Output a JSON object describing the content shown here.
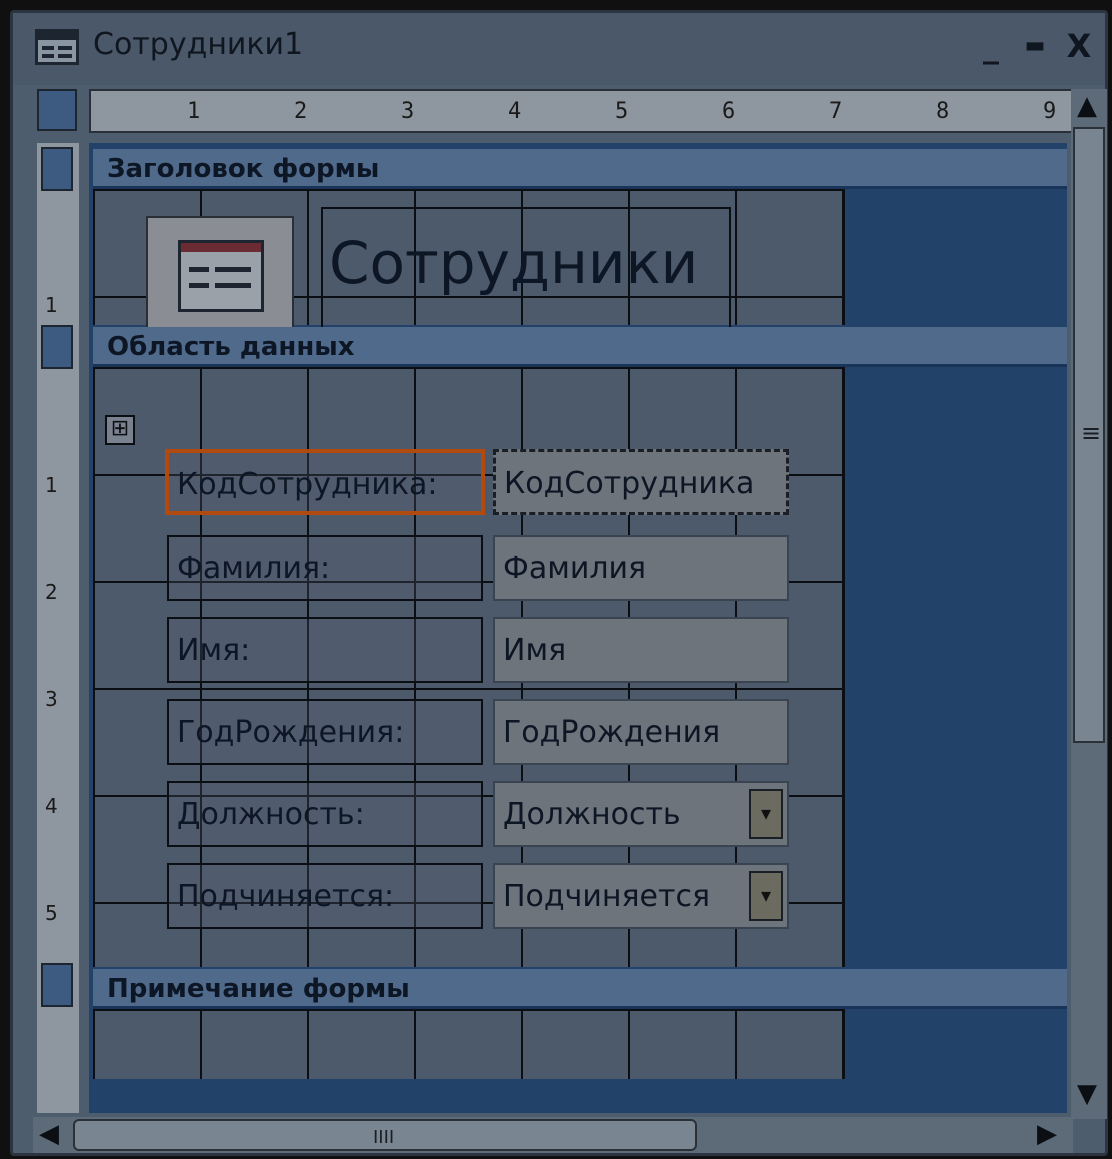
{
  "window": {
    "title": "Сотрудники1",
    "minimize_glyph": "_",
    "maximize_glyph": "▬",
    "close_glyph": "X"
  },
  "ruler": {
    "horizontal": [
      "1",
      "2",
      "3",
      "4",
      "5",
      "6",
      "7",
      "8",
      "9"
    ],
    "vertical": [
      "1",
      "1",
      "2",
      "3",
      "4",
      "5"
    ]
  },
  "sections": {
    "header": "Заголовок формы",
    "detail": "Область данных",
    "footer": "Примечание формы"
  },
  "header": {
    "title": "Сотрудники",
    "logo_icon": "form-icon"
  },
  "controls": [
    {
      "label": "КодСотрудника:",
      "field": "КодСотрудника",
      "kind": "text",
      "selected": true
    },
    {
      "label": "Фамилия:",
      "field": "Фамилия",
      "kind": "text",
      "selected": false
    },
    {
      "label": "Имя:",
      "field": "Имя",
      "kind": "text",
      "selected": false
    },
    {
      "label": "ГодРождения:",
      "field": "ГодРождения",
      "kind": "text",
      "selected": false
    },
    {
      "label": "Должность:",
      "field": "Должность",
      "kind": "combo",
      "selected": false
    },
    {
      "label": "Подчиняется:",
      "field": "Подчиняется",
      "kind": "combo",
      "selected": false
    }
  ],
  "icons": {
    "move_handle": "⊞",
    "combo_arrow": "▾",
    "scroll_up": "▲",
    "scroll_down": "▼",
    "scroll_left": "◀",
    "scroll_right": "▶",
    "grip_h": "IIII",
    "grip_v": "≡"
  },
  "colors": {
    "selection": "#b04a0e",
    "canvas": "#22426a"
  }
}
